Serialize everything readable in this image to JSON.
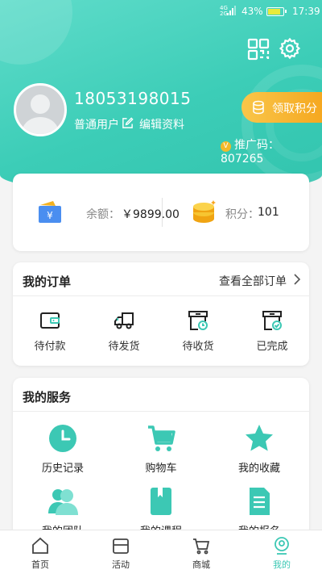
{
  "status_bar": {
    "network": "4G",
    "network2": "2G",
    "battery": "43%",
    "battery_level": 0.43,
    "time": "17:39"
  },
  "profile": {
    "phone": "18053198015",
    "user_type": "普通用户",
    "edit_label": "编辑资料",
    "claim_points_label": "领取积分",
    "promo_label": "推广码：",
    "promo_code": "807265",
    "promo_badge": "V"
  },
  "wallet": {
    "balance_label": "余额：",
    "balance_value": "￥9899.00",
    "points_label": "积分：",
    "points_value": "101"
  },
  "orders": {
    "title": "我的订单",
    "view_all": "查看全部订单",
    "items": [
      {
        "label": "待付款",
        "icon": "wallet-icon"
      },
      {
        "label": "待发货",
        "icon": "truck-icon"
      },
      {
        "label": "待收货",
        "icon": "box-clock-icon"
      },
      {
        "label": "已完成",
        "icon": "box-check-icon"
      }
    ]
  },
  "services": {
    "title": "我的服务",
    "items": [
      {
        "label": "历史记录",
        "icon": "clock-icon"
      },
      {
        "label": "购物车",
        "icon": "cart-icon"
      },
      {
        "label": "我的收藏",
        "icon": "star-icon"
      },
      {
        "label": "我的团队",
        "icon": "team-icon"
      },
      {
        "label": "我的课程",
        "icon": "course-icon"
      },
      {
        "label": "我的报名",
        "icon": "signup-icon"
      }
    ]
  },
  "tabs": [
    {
      "label": "首页",
      "icon": "home-icon"
    },
    {
      "label": "活动",
      "icon": "activity-icon"
    },
    {
      "label": "商城",
      "icon": "shop-cart-icon"
    },
    {
      "label": "我的",
      "icon": "profile-icon",
      "active": true
    }
  ],
  "colors": {
    "accent": "#3ccdb7",
    "gold": "#f5a51c",
    "icon_teal": "#3cc8b4"
  }
}
